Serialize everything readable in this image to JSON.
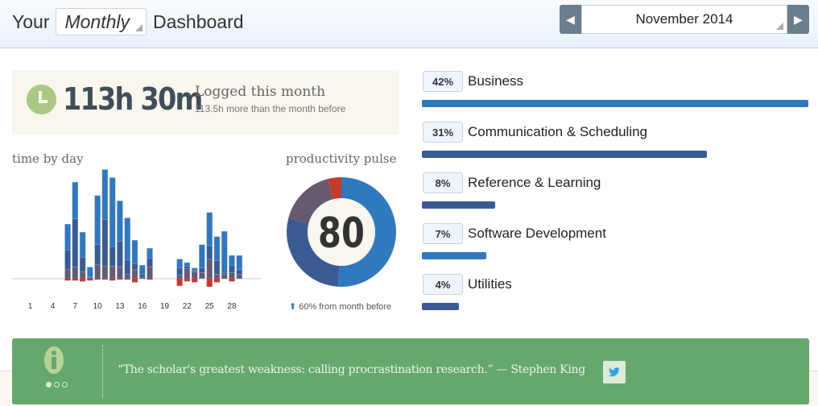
{
  "header": {
    "prefix": "Your",
    "period": "Monthly",
    "suffix": "Dashboard",
    "date": "November 2014",
    "prev_icon": "chevron-left-icon",
    "next_icon": "chevron-right-icon"
  },
  "logged": {
    "value": "113h 30m",
    "label": "Logged this month",
    "sub": "113.5h more than the month before",
    "icon": "clock-icon"
  },
  "time_by_day": {
    "title": "time by day"
  },
  "pulse": {
    "title": "productivity pulse",
    "score": "80",
    "change": "60% from month before",
    "change_icon": "arrow-up-icon"
  },
  "categories": [
    {
      "pct": "42%",
      "name": "Business",
      "value": 42,
      "color": "#3079c0"
    },
    {
      "pct": "31%",
      "name": "Communication & Scheduling",
      "value": 31,
      "color": "#3a5a94"
    },
    {
      "pct": "8%",
      "name": "Reference & Learning",
      "value": 8,
      "color": "#3a5a94"
    },
    {
      "pct": "7%",
      "name": "Software Development",
      "value": 7,
      "color": "#3079c0"
    },
    {
      "pct": "4%",
      "name": "Utilities",
      "value": 4,
      "color": "#3a5a94"
    }
  ],
  "quote": {
    "text": "“The scholar's greatest weakness: calling procrastination research.” — Stephen King",
    "icon": "info-icon",
    "share_icon": "twitter-icon"
  },
  "chart_data": [
    {
      "type": "bar",
      "stacked": true,
      "title": "time by day",
      "xlabel": "",
      "ylabel": "",
      "categories": [
        1,
        2,
        3,
        4,
        5,
        6,
        7,
        8,
        9,
        10,
        11,
        12,
        13,
        14,
        15,
        16,
        17,
        18,
        19,
        20,
        21,
        22,
        23,
        24,
        25,
        26,
        27,
        28,
        29,
        30
      ],
      "tick_labels": [
        "1",
        "4",
        "7",
        "10",
        "13",
        "16",
        "19",
        "22",
        "25",
        "28"
      ],
      "series": [
        {
          "key": "very_productive",
          "color": "#3079c0",
          "values": [
            0,
            0,
            0,
            0,
            0,
            2.9,
            4.1,
            2.8,
            1.1,
            5.5,
            5.6,
            7.7,
            4.5,
            4.7,
            2.6,
            1.0,
            1.1,
            0,
            0,
            0,
            1.0,
            0.4,
            0.3,
            2.6,
            3.7,
            2.7,
            4.6,
            1.1,
            1.6,
            0
          ]
        },
        {
          "key": "productive",
          "color": "#3a5a94",
          "values": [
            0,
            0,
            0,
            0,
            0,
            2.2,
            5.4,
            1.6,
            0.1,
            2.2,
            5.2,
            2.2,
            2.9,
            1.6,
            0.7,
            0.3,
            1.0,
            0,
            0,
            0,
            0.8,
            0.3,
            0.1,
            0.5,
            1.5,
            1.5,
            0.2,
            0.8,
            0.5,
            0
          ]
        },
        {
          "key": "neutral",
          "color": "#665a72",
          "values": [
            0,
            0,
            0,
            0,
            0,
            1.0,
            1.3,
            0.8,
            0.1,
            1.6,
            1.4,
            1.4,
            1.3,
            0.5,
            1.0,
            0.2,
            1.3,
            0,
            0,
            0,
            0.4,
            1.1,
            0.8,
            0.7,
            2.2,
            0.5,
            0.5,
            0.7,
            0.5,
            0
          ]
        },
        {
          "key": "distracting",
          "color": "#c8392d",
          "values": [
            0,
            0,
            0,
            0,
            0,
            0.2,
            0.2,
            0.3,
            0.2,
            0.1,
            0.1,
            0.2,
            0.1,
            0.1,
            0.4,
            0,
            0.1,
            0,
            0,
            0,
            0.8,
            0.3,
            0.4,
            0,
            0.9,
            0.4,
            0,
            0.3,
            0,
            0
          ]
        }
      ]
    },
    {
      "type": "pie",
      "donut": true,
      "title": "productivity pulse",
      "center_label": "80",
      "slices": [
        {
          "key": "very_productive",
          "value": 51,
          "color": "#3079c0"
        },
        {
          "key": "productive",
          "value": 28,
          "color": "#3a5a94"
        },
        {
          "key": "neutral",
          "value": 17,
          "color": "#665a72"
        },
        {
          "key": "distracting",
          "value": 4,
          "color": "#c8392d"
        }
      ]
    }
  ]
}
